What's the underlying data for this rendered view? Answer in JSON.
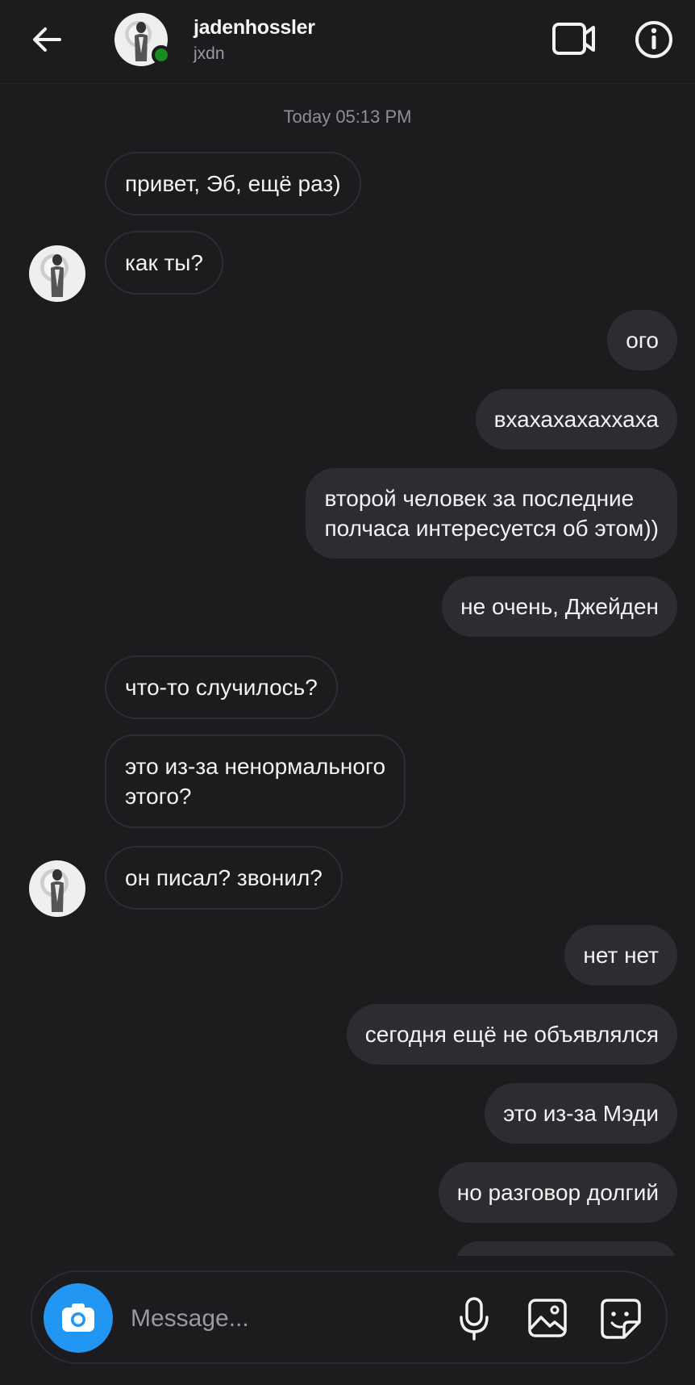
{
  "header": {
    "username": "jadenhossler",
    "subname": "jxdn",
    "online_color": "#1a8b1f",
    "icons": [
      "back-arrow-icon",
      "video-call-icon",
      "info-icon"
    ]
  },
  "chat": {
    "timestamp": "Today 05:13 PM",
    "messages": [
      {
        "from": "them",
        "text": "привет, Эб, ещё раз)"
      },
      {
        "from": "them",
        "text": "как ты?"
      },
      {
        "from": "me",
        "text": "ого"
      },
      {
        "from": "me",
        "text": "вхахахахаххаха"
      },
      {
        "from": "me",
        "lines": [
          "второй человек за последние",
          "полчаса интересуется об этом))"
        ]
      },
      {
        "from": "me",
        "text": "не очень, Джейден"
      },
      {
        "from": "them",
        "text": "что-то случилось?"
      },
      {
        "from": "them",
        "lines": [
          "это из-за ненормального",
          "этого?"
        ]
      },
      {
        "from": "them",
        "text": "он писал? звонил?"
      },
      {
        "from": "me",
        "text": "нет нет"
      },
      {
        "from": "me",
        "text": "сегодня ещё не объявлялся"
      },
      {
        "from": "me",
        "text": "это из-за Мэди"
      },
      {
        "from": "me",
        "text": "но разговор долгий"
      }
    ]
  },
  "composer": {
    "placeholder": "Message...",
    "camera_color": "#2196f3",
    "icons": [
      "camera-icon",
      "microphone-icon",
      "gallery-icon",
      "sticker-icon"
    ]
  }
}
